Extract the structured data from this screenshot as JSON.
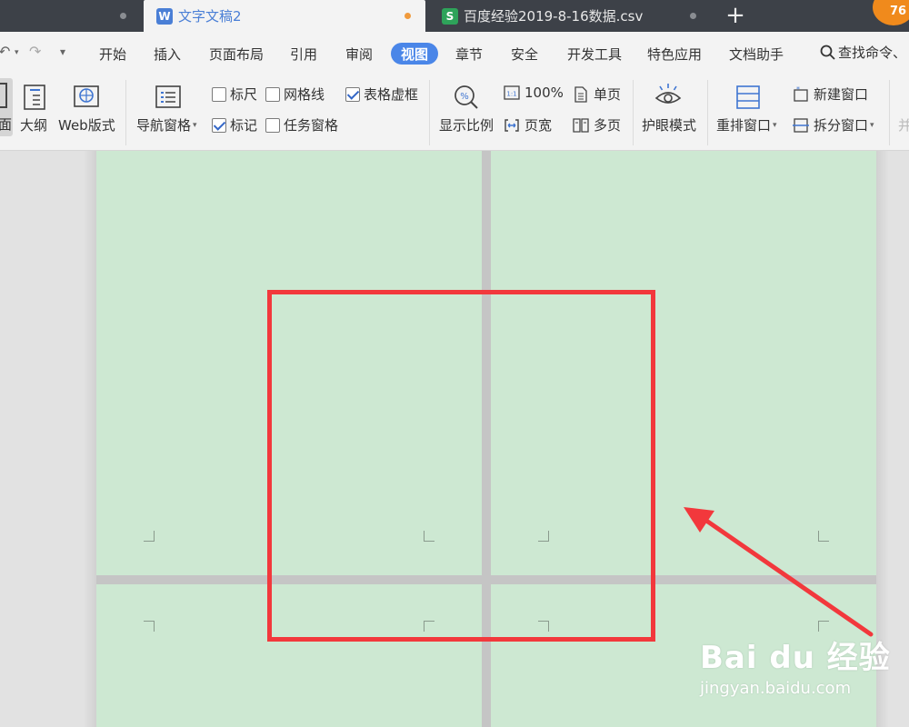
{
  "tabs": [
    {
      "label": "文字文稿2",
      "icon": "wps-writer-icon",
      "active": true,
      "modified_dot_color": "#f09a3c"
    },
    {
      "label": "百度经验2019-8-16数据.csv",
      "icon": "wps-spreadsheet-icon",
      "active": false
    }
  ],
  "notification_badge": "76",
  "menu": {
    "items": [
      "开始",
      "插入",
      "页面布局",
      "引用",
      "审阅",
      "视图",
      "章节",
      "安全",
      "开发工具",
      "特色应用",
      "文档助手"
    ],
    "active": "视图",
    "search_label": "查找命令、"
  },
  "ribbon": {
    "view_modes": {
      "page_partial": "面",
      "outline": "大纲",
      "web": "Web版式"
    },
    "nav_pane": "导航窗格",
    "checkboxes": {
      "ruler": {
        "label": "标尺",
        "checked": false
      },
      "gridlines": {
        "label": "网格线",
        "checked": false
      },
      "table_gridlines": {
        "label": "表格虚框",
        "checked": true
      },
      "marks": {
        "label": "标记",
        "checked": true
      },
      "task_pane": {
        "label": "任务窗格",
        "checked": false
      }
    },
    "zoom": {
      "display_ratio": "显示比例",
      "hundred": "100%",
      "page_width": "页宽",
      "single_page": "单页",
      "multi_page": "多页"
    },
    "eye_protection": "护眼模式",
    "window": {
      "rearrange": "重排窗口",
      "new_window": "新建窗口",
      "split_window": "拆分窗口"
    }
  },
  "colors": {
    "accent": "#4a86e8",
    "page_green": "#cde8d2",
    "annotation_red": "#f2383c"
  },
  "watermark": {
    "brand": "Bai du 经验",
    "url": "jingyan.baidu.com"
  }
}
